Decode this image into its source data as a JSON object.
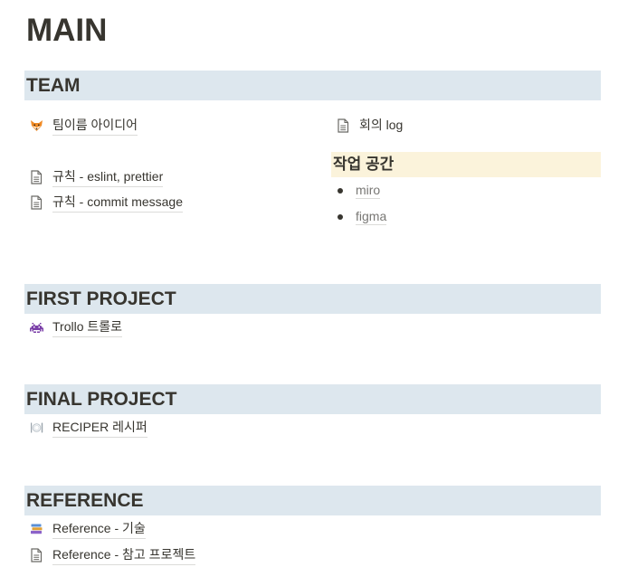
{
  "page": {
    "title": "MAIN"
  },
  "sections": {
    "team": {
      "title": "TEAM",
      "links": [
        {
          "label": "팀이름 아이디어",
          "icon": "fox-emoji-icon"
        },
        {
          "label": "규칙 - eslint, prettier",
          "icon": "page-icon"
        },
        {
          "label": "규칙 - commit message",
          "icon": "page-icon"
        },
        {
          "label": "회의 log",
          "icon": "page-icon"
        }
      ],
      "workspace": {
        "title": "작업 공간",
        "items": [
          {
            "label": "miro"
          },
          {
            "label": "figma"
          }
        ]
      }
    },
    "first_project": {
      "title": "FIRST PROJECT",
      "links": [
        {
          "label": "Trollo 트롤로",
          "icon": "space-invader-icon"
        }
      ]
    },
    "final_project": {
      "title": "FINAL PROJECT",
      "links": [
        {
          "label": "RECIPER 레시퍼",
          "icon": "fork-knife-plate-icon"
        }
      ]
    },
    "reference": {
      "title": "REFERENCE",
      "links": [
        {
          "label": "Reference - 기술",
          "icon": "books-icon"
        },
        {
          "label": "Reference - 참고 프로젝트",
          "icon": "page-icon"
        }
      ]
    }
  },
  "colors": {
    "section_header_bg": "#dde7ee",
    "workspace_header_bg": "#fbf3db",
    "text": "#37352f",
    "muted_text": "#787774"
  }
}
